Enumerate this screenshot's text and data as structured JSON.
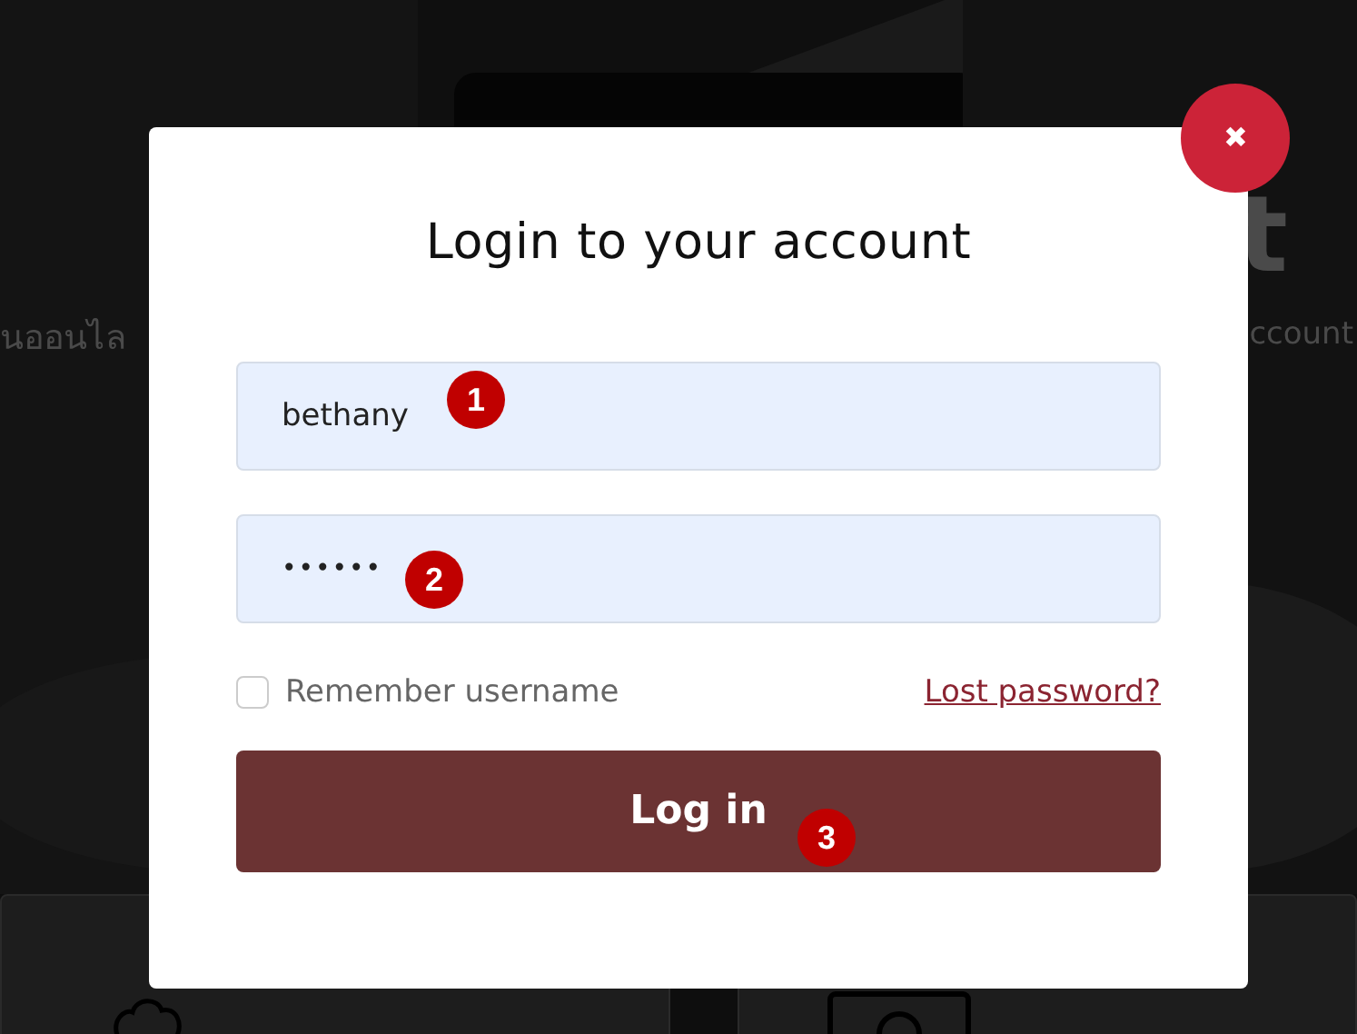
{
  "background": {
    "headline_fragment": "t",
    "subtitle_left": "นออนไล",
    "subtitle_right": "ccount"
  },
  "modal": {
    "close": "✖",
    "title": "Login to your account",
    "fields": [
      {
        "kind": "text",
        "value": "bethany",
        "marker": "1"
      },
      {
        "kind": "password",
        "value": "••••••",
        "marker": "2"
      }
    ],
    "remember": {
      "label": "Remember username",
      "checked": false
    },
    "lost_password": "Lost password?",
    "submit": {
      "label": "Log in",
      "marker": "3"
    }
  }
}
